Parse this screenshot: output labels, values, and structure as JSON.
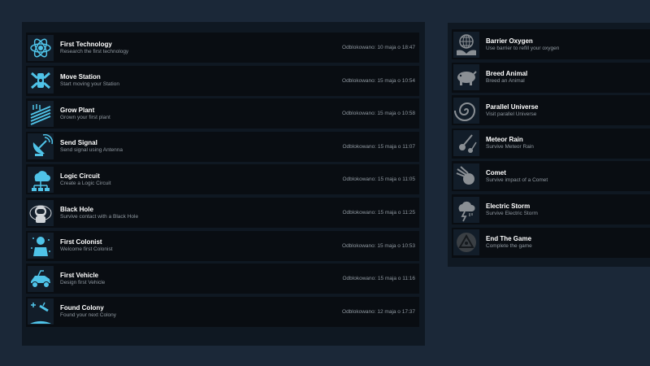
{
  "unlocked": [
    {
      "title": "First Technology",
      "desc": "Research the first technology",
      "date": "Odblokowano: 10 maja o 18:47",
      "icon": "atom-icon"
    },
    {
      "title": "Move Station",
      "desc": "Start moving your Station",
      "date": "Odblokowano: 15 maja o 10:54",
      "icon": "station-icon"
    },
    {
      "title": "Grow Plant",
      "desc": "Grown your first plant",
      "date": "Odblokowano: 15 maja o 10:58",
      "icon": "field-icon"
    },
    {
      "title": "Send Signal",
      "desc": "Send signal using Antenna",
      "date": "Odblokowano: 15 maja o 11:07",
      "icon": "satellite-dish-icon"
    },
    {
      "title": "Logic Circuit",
      "desc": "Create a Logic Circuit",
      "date": "Odblokowano: 15 maja o 11:05",
      "icon": "cloud-circuit-icon"
    },
    {
      "title": "Black Hole",
      "desc": "Survive contact with a Black Hole",
      "date": "Odblokowano: 15 maja o 11:25",
      "icon": "astronaut-icon"
    },
    {
      "title": "First Colonist",
      "desc": "Welcome first Colonist",
      "date": "Odblokowano: 15 maja o 10:53",
      "icon": "colonist-icon"
    },
    {
      "title": "First Vehicle",
      "desc": "Design first Vehicle",
      "date": "Odblokowano: 15 maja o 11:16",
      "icon": "rover-icon"
    },
    {
      "title": "Found Colony",
      "desc": "Found your next Colony",
      "date": "Odblokowano: 12 maja o 17:37",
      "icon": "planet-icon"
    }
  ],
  "locked": [
    {
      "title": "Barrier Oxygen",
      "desc": "Use barrier to refill your oxygen",
      "icon": "globe-hand-icon"
    },
    {
      "title": "Breed Animal",
      "desc": "Breed an Animal",
      "icon": "pig-icon"
    },
    {
      "title": "Parallel Universe",
      "desc": "Visit parallel Universe",
      "icon": "spiral-galaxy-icon"
    },
    {
      "title": "Meteor Rain",
      "desc": "Survive Meteor Rain",
      "icon": "meteors-icon"
    },
    {
      "title": "Comet",
      "desc": "Survive impact of a Comet",
      "icon": "comet-icon"
    },
    {
      "title": "Electric Storm",
      "desc": "Survive Electric Storm",
      "icon": "storm-cloud-icon"
    },
    {
      "title": "End The Game",
      "desc": "Complete the game",
      "icon": "triangle-emblem-icon"
    }
  ],
  "colors": {
    "page_bg": "#1b2838",
    "panel_bg": "#0f1822",
    "row_bg": "#090d12",
    "icon_unlocked": "#4fc3e8",
    "icon_locked": "#8a8f94"
  }
}
